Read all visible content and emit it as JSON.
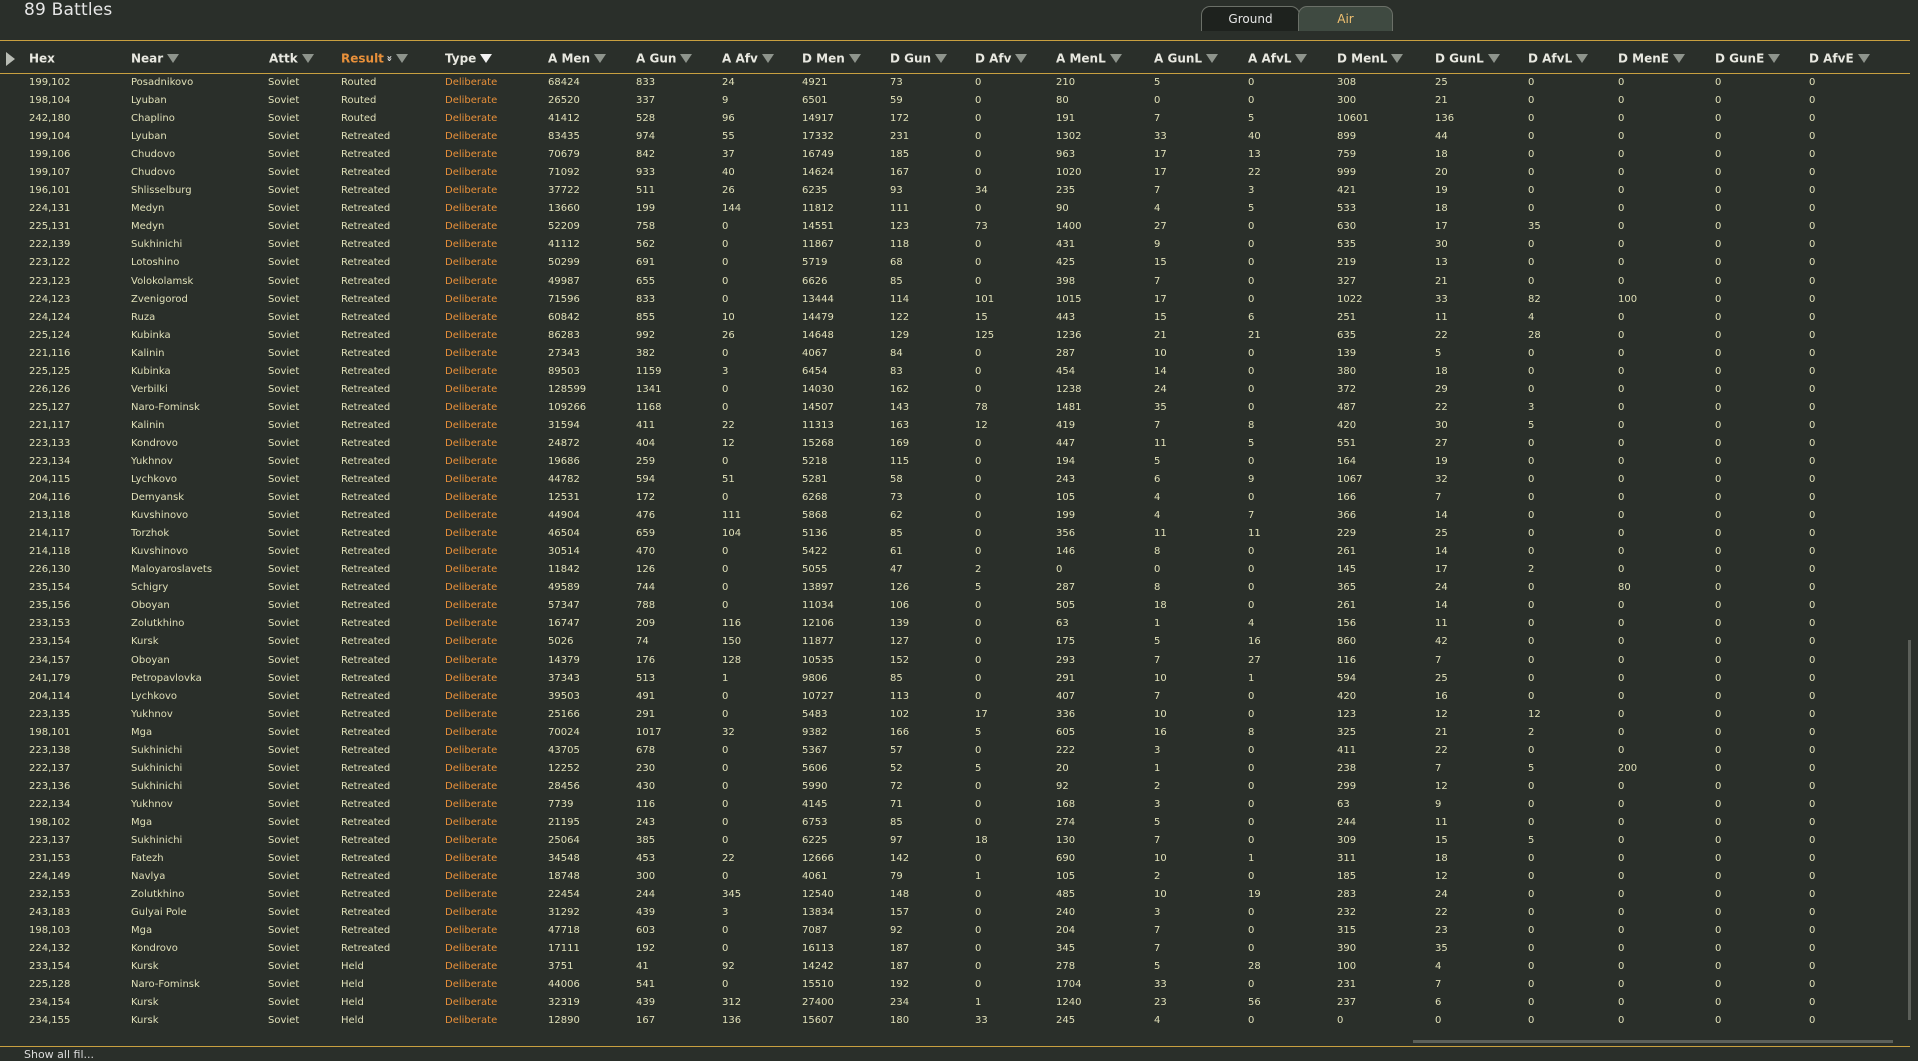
{
  "title": "89 Battles",
  "tabs": [
    {
      "label": "Ground"
    },
    {
      "label": "Air"
    }
  ],
  "footer": "Show all fil...",
  "columns": [
    "Hex",
    "Near",
    "Attk",
    "Result",
    "Type",
    "A Men",
    "A Gun",
    "A Afv",
    "D Men",
    "D Gun",
    "D Afv",
    "A MenL",
    "A GunL",
    "A AfvL",
    "D MenL",
    "D GunL",
    "D AfvL",
    "D MenE",
    "D GunE",
    "D AfvE"
  ],
  "colors": {
    "type_text": "#e8903a",
    "result_header": "#e8903a",
    "accent_line": "#c8a040"
  },
  "rows": [
    [
      "199,102",
      "Posadnikovo",
      "Soviet",
      "Routed",
      "Deliberate",
      "68424",
      "833",
      "24",
      "4921",
      "73",
      "0",
      "210",
      "5",
      "0",
      "308",
      "25",
      "0",
      "0",
      "0",
      "0"
    ],
    [
      "198,104",
      "Lyuban",
      "Soviet",
      "Routed",
      "Deliberate",
      "26520",
      "337",
      "9",
      "6501",
      "59",
      "0",
      "80",
      "0",
      "0",
      "300",
      "21",
      "0",
      "0",
      "0",
      "0"
    ],
    [
      "242,180",
      "Chaplino",
      "Soviet",
      "Routed",
      "Deliberate",
      "41412",
      "528",
      "96",
      "14917",
      "172",
      "0",
      "191",
      "7",
      "5",
      "10601",
      "136",
      "0",
      "0",
      "0",
      "0"
    ],
    [
      "199,104",
      "Lyuban",
      "Soviet",
      "Retreated",
      "Deliberate",
      "83435",
      "974",
      "55",
      "17332",
      "231",
      "0",
      "1302",
      "33",
      "40",
      "899",
      "44",
      "0",
      "0",
      "0",
      "0"
    ],
    [
      "199,106",
      "Chudovo",
      "Soviet",
      "Retreated",
      "Deliberate",
      "70679",
      "842",
      "37",
      "16749",
      "185",
      "0",
      "963",
      "17",
      "13",
      "759",
      "18",
      "0",
      "0",
      "0",
      "0"
    ],
    [
      "199,107",
      "Chudovo",
      "Soviet",
      "Retreated",
      "Deliberate",
      "71092",
      "933",
      "40",
      "14624",
      "167",
      "0",
      "1020",
      "17",
      "22",
      "999",
      "20",
      "0",
      "0",
      "0",
      "0"
    ],
    [
      "196,101",
      "Shlisselburg",
      "Soviet",
      "Retreated",
      "Deliberate",
      "37722",
      "511",
      "26",
      "6235",
      "93",
      "34",
      "235",
      "7",
      "3",
      "421",
      "19",
      "0",
      "0",
      "0",
      "0"
    ],
    [
      "224,131",
      "Medyn",
      "Soviet",
      "Retreated",
      "Deliberate",
      "13660",
      "199",
      "144",
      "11812",
      "111",
      "0",
      "90",
      "4",
      "5",
      "533",
      "18",
      "0",
      "0",
      "0",
      "0"
    ],
    [
      "225,131",
      "Medyn",
      "Soviet",
      "Retreated",
      "Deliberate",
      "52209",
      "758",
      "0",
      "14551",
      "123",
      "73",
      "1400",
      "27",
      "0",
      "630",
      "17",
      "35",
      "0",
      "0",
      "0"
    ],
    [
      "222,139",
      "Sukhinichi",
      "Soviet",
      "Retreated",
      "Deliberate",
      "41112",
      "562",
      "0",
      "11867",
      "118",
      "0",
      "431",
      "9",
      "0",
      "535",
      "30",
      "0",
      "0",
      "0",
      "0"
    ],
    [
      "223,122",
      "Lotoshino",
      "Soviet",
      "Retreated",
      "Deliberate",
      "50299",
      "691",
      "0",
      "5719",
      "68",
      "0",
      "425",
      "15",
      "0",
      "219",
      "13",
      "0",
      "0",
      "0",
      "0"
    ],
    [
      "223,123",
      "Volokolamsk",
      "Soviet",
      "Retreated",
      "Deliberate",
      "49987",
      "655",
      "0",
      "6626",
      "85",
      "0",
      "398",
      "7",
      "0",
      "327",
      "21",
      "0",
      "0",
      "0",
      "0"
    ],
    [
      "224,123",
      "Zvenigorod",
      "Soviet",
      "Retreated",
      "Deliberate",
      "71596",
      "833",
      "0",
      "13444",
      "114",
      "101",
      "1015",
      "17",
      "0",
      "1022",
      "33",
      "82",
      "100",
      "0",
      "0"
    ],
    [
      "224,124",
      "Ruza",
      "Soviet",
      "Retreated",
      "Deliberate",
      "60842",
      "855",
      "10",
      "14479",
      "122",
      "15",
      "443",
      "15",
      "6",
      "251",
      "11",
      "4",
      "0",
      "0",
      "0"
    ],
    [
      "225,124",
      "Kubinka",
      "Soviet",
      "Retreated",
      "Deliberate",
      "86283",
      "992",
      "26",
      "14648",
      "129",
      "125",
      "1236",
      "21",
      "21",
      "635",
      "22",
      "28",
      "0",
      "0",
      "0"
    ],
    [
      "221,116",
      "Kalinin",
      "Soviet",
      "Retreated",
      "Deliberate",
      "27343",
      "382",
      "0",
      "4067",
      "84",
      "0",
      "287",
      "10",
      "0",
      "139",
      "5",
      "0",
      "0",
      "0",
      "0"
    ],
    [
      "225,125",
      "Kubinka",
      "Soviet",
      "Retreated",
      "Deliberate",
      "89503",
      "1159",
      "3",
      "6454",
      "83",
      "0",
      "454",
      "14",
      "0",
      "380",
      "18",
      "0",
      "0",
      "0",
      "0"
    ],
    [
      "226,126",
      "Verbilki",
      "Soviet",
      "Retreated",
      "Deliberate",
      "128599",
      "1341",
      "0",
      "14030",
      "162",
      "0",
      "1238",
      "24",
      "0",
      "372",
      "29",
      "0",
      "0",
      "0",
      "0"
    ],
    [
      "225,127",
      "Naro-Fominsk",
      "Soviet",
      "Retreated",
      "Deliberate",
      "109266",
      "1168",
      "0",
      "14507",
      "143",
      "78",
      "1481",
      "35",
      "0",
      "487",
      "22",
      "3",
      "0",
      "0",
      "0"
    ],
    [
      "221,117",
      "Kalinin",
      "Soviet",
      "Retreated",
      "Deliberate",
      "31594",
      "411",
      "22",
      "11313",
      "163",
      "12",
      "419",
      "7",
      "8",
      "420",
      "30",
      "5",
      "0",
      "0",
      "0"
    ],
    [
      "223,133",
      "Kondrovo",
      "Soviet",
      "Retreated",
      "Deliberate",
      "24872",
      "404",
      "12",
      "15268",
      "169",
      "0",
      "447",
      "11",
      "5",
      "551",
      "27",
      "0",
      "0",
      "0",
      "0"
    ],
    [
      "223,134",
      "Yukhnov",
      "Soviet",
      "Retreated",
      "Deliberate",
      "19686",
      "259",
      "0",
      "5218",
      "115",
      "0",
      "194",
      "5",
      "0",
      "164",
      "19",
      "0",
      "0",
      "0",
      "0"
    ],
    [
      "204,115",
      "Lychkovo",
      "Soviet",
      "Retreated",
      "Deliberate",
      "44782",
      "594",
      "51",
      "5281",
      "58",
      "0",
      "243",
      "6",
      "9",
      "1067",
      "32",
      "0",
      "0",
      "0",
      "0"
    ],
    [
      "204,116",
      "Demyansk",
      "Soviet",
      "Retreated",
      "Deliberate",
      "12531",
      "172",
      "0",
      "6268",
      "73",
      "0",
      "105",
      "4",
      "0",
      "166",
      "7",
      "0",
      "0",
      "0",
      "0"
    ],
    [
      "213,118",
      "Kuvshinovo",
      "Soviet",
      "Retreated",
      "Deliberate",
      "44904",
      "476",
      "111",
      "5868",
      "62",
      "0",
      "199",
      "4",
      "7",
      "366",
      "14",
      "0",
      "0",
      "0",
      "0"
    ],
    [
      "214,117",
      "Torzhok",
      "Soviet",
      "Retreated",
      "Deliberate",
      "46504",
      "659",
      "104",
      "5136",
      "85",
      "0",
      "356",
      "11",
      "11",
      "229",
      "25",
      "0",
      "0",
      "0",
      "0"
    ],
    [
      "214,118",
      "Kuvshinovo",
      "Soviet",
      "Retreated",
      "Deliberate",
      "30514",
      "470",
      "0",
      "5422",
      "61",
      "0",
      "146",
      "8",
      "0",
      "261",
      "14",
      "0",
      "0",
      "0",
      "0"
    ],
    [
      "226,130",
      "Maloyaroslavets",
      "Soviet",
      "Retreated",
      "Deliberate",
      "11842",
      "126",
      "0",
      "5055",
      "47",
      "2",
      "0",
      "0",
      "0",
      "145",
      "17",
      "2",
      "0",
      "0",
      "0"
    ],
    [
      "235,154",
      "Schigry",
      "Soviet",
      "Retreated",
      "Deliberate",
      "49589",
      "744",
      "0",
      "13897",
      "126",
      "5",
      "287",
      "8",
      "0",
      "365",
      "24",
      "0",
      "80",
      "0",
      "0"
    ],
    [
      "235,156",
      "Oboyan",
      "Soviet",
      "Retreated",
      "Deliberate",
      "57347",
      "788",
      "0",
      "11034",
      "106",
      "0",
      "505",
      "18",
      "0",
      "261",
      "14",
      "0",
      "0",
      "0",
      "0"
    ],
    [
      "233,153",
      "Zolutkhino",
      "Soviet",
      "Retreated",
      "Deliberate",
      "16747",
      "209",
      "116",
      "12106",
      "139",
      "0",
      "63",
      "1",
      "4",
      "156",
      "11",
      "0",
      "0",
      "0",
      "0"
    ],
    [
      "233,154",
      "Kursk",
      "Soviet",
      "Retreated",
      "Deliberate",
      "5026",
      "74",
      "150",
      "11877",
      "127",
      "0",
      "175",
      "5",
      "16",
      "860",
      "42",
      "0",
      "0",
      "0",
      "0"
    ],
    [
      "234,157",
      "Oboyan",
      "Soviet",
      "Retreated",
      "Deliberate",
      "14379",
      "176",
      "128",
      "10535",
      "152",
      "0",
      "293",
      "7",
      "27",
      "116",
      "7",
      "0",
      "0",
      "0",
      "0"
    ],
    [
      "241,179",
      "Petropavlovka",
      "Soviet",
      "Retreated",
      "Deliberate",
      "37343",
      "513",
      "1",
      "9806",
      "85",
      "0",
      "291",
      "10",
      "1",
      "594",
      "25",
      "0",
      "0",
      "0",
      "0"
    ],
    [
      "204,114",
      "Lychkovo",
      "Soviet",
      "Retreated",
      "Deliberate",
      "39503",
      "491",
      "0",
      "10727",
      "113",
      "0",
      "407",
      "7",
      "0",
      "420",
      "16",
      "0",
      "0",
      "0",
      "0"
    ],
    [
      "223,135",
      "Yukhnov",
      "Soviet",
      "Retreated",
      "Deliberate",
      "25166",
      "291",
      "0",
      "5483",
      "102",
      "17",
      "336",
      "10",
      "0",
      "123",
      "12",
      "12",
      "0",
      "0",
      "0"
    ],
    [
      "198,101",
      "Mga",
      "Soviet",
      "Retreated",
      "Deliberate",
      "70024",
      "1017",
      "32",
      "9382",
      "166",
      "5",
      "605",
      "16",
      "8",
      "325",
      "21",
      "2",
      "0",
      "0",
      "0"
    ],
    [
      "223,138",
      "Sukhinichi",
      "Soviet",
      "Retreated",
      "Deliberate",
      "43705",
      "678",
      "0",
      "5367",
      "57",
      "0",
      "222",
      "3",
      "0",
      "411",
      "22",
      "0",
      "0",
      "0",
      "0"
    ],
    [
      "222,137",
      "Sukhinichi",
      "Soviet",
      "Retreated",
      "Deliberate",
      "12252",
      "230",
      "0",
      "5606",
      "52",
      "5",
      "20",
      "1",
      "0",
      "238",
      "7",
      "5",
      "200",
      "0",
      "0"
    ],
    [
      "223,136",
      "Sukhinichi",
      "Soviet",
      "Retreated",
      "Deliberate",
      "28456",
      "430",
      "0",
      "5990",
      "72",
      "0",
      "92",
      "2",
      "0",
      "299",
      "12",
      "0",
      "0",
      "0",
      "0"
    ],
    [
      "222,134",
      "Yukhnov",
      "Soviet",
      "Retreated",
      "Deliberate",
      "7739",
      "116",
      "0",
      "4145",
      "71",
      "0",
      "168",
      "3",
      "0",
      "63",
      "9",
      "0",
      "0",
      "0",
      "0"
    ],
    [
      "198,102",
      "Mga",
      "Soviet",
      "Retreated",
      "Deliberate",
      "21195",
      "243",
      "0",
      "6753",
      "85",
      "0",
      "274",
      "5",
      "0",
      "244",
      "11",
      "0",
      "0",
      "0",
      "0"
    ],
    [
      "223,137",
      "Sukhinichi",
      "Soviet",
      "Retreated",
      "Deliberate",
      "25064",
      "385",
      "0",
      "6225",
      "97",
      "18",
      "130",
      "7",
      "0",
      "309",
      "15",
      "5",
      "0",
      "0",
      "0"
    ],
    [
      "231,153",
      "Fatezh",
      "Soviet",
      "Retreated",
      "Deliberate",
      "34548",
      "453",
      "22",
      "12666",
      "142",
      "0",
      "690",
      "10",
      "1",
      "311",
      "18",
      "0",
      "0",
      "0",
      "0"
    ],
    [
      "224,149",
      "Navlya",
      "Soviet",
      "Retreated",
      "Deliberate",
      "18748",
      "300",
      "0",
      "4061",
      "79",
      "1",
      "105",
      "2",
      "0",
      "185",
      "12",
      "0",
      "0",
      "0",
      "0"
    ],
    [
      "232,153",
      "Zolutkhino",
      "Soviet",
      "Retreated",
      "Deliberate",
      "22454",
      "244",
      "345",
      "12540",
      "148",
      "0",
      "485",
      "10",
      "19",
      "283",
      "24",
      "0",
      "0",
      "0",
      "0"
    ],
    [
      "243,183",
      "Gulyai Pole",
      "Soviet",
      "Retreated",
      "Deliberate",
      "31292",
      "439",
      "3",
      "13834",
      "157",
      "0",
      "240",
      "3",
      "0",
      "232",
      "22",
      "0",
      "0",
      "0",
      "0"
    ],
    [
      "198,103",
      "Mga",
      "Soviet",
      "Retreated",
      "Deliberate",
      "47718",
      "603",
      "0",
      "7087",
      "92",
      "0",
      "204",
      "7",
      "0",
      "315",
      "23",
      "0",
      "0",
      "0",
      "0"
    ],
    [
      "224,132",
      "Kondrovo",
      "Soviet",
      "Retreated",
      "Deliberate",
      "17111",
      "192",
      "0",
      "16113",
      "187",
      "0",
      "345",
      "7",
      "0",
      "390",
      "35",
      "0",
      "0",
      "0",
      "0"
    ],
    [
      "233,154",
      "Kursk",
      "Soviet",
      "Held",
      "Deliberate",
      "3751",
      "41",
      "92",
      "14242",
      "187",
      "0",
      "278",
      "5",
      "28",
      "100",
      "4",
      "0",
      "0",
      "0",
      "0"
    ],
    [
      "225,128",
      "Naro-Fominsk",
      "Soviet",
      "Held",
      "Deliberate",
      "44006",
      "541",
      "0",
      "15510",
      "192",
      "0",
      "1704",
      "33",
      "0",
      "231",
      "7",
      "0",
      "0",
      "0",
      "0"
    ],
    [
      "234,154",
      "Kursk",
      "Soviet",
      "Held",
      "Deliberate",
      "32319",
      "439",
      "312",
      "27400",
      "234",
      "1",
      "1240",
      "23",
      "56",
      "237",
      "6",
      "0",
      "0",
      "0",
      "0"
    ],
    [
      "234,155",
      "Kursk",
      "Soviet",
      "Held",
      "Deliberate",
      "12890",
      "167",
      "136",
      "15607",
      "180",
      "33",
      "245",
      "4",
      "0",
      "0",
      "0",
      "0",
      "0",
      "0",
      "0"
    ]
  ]
}
